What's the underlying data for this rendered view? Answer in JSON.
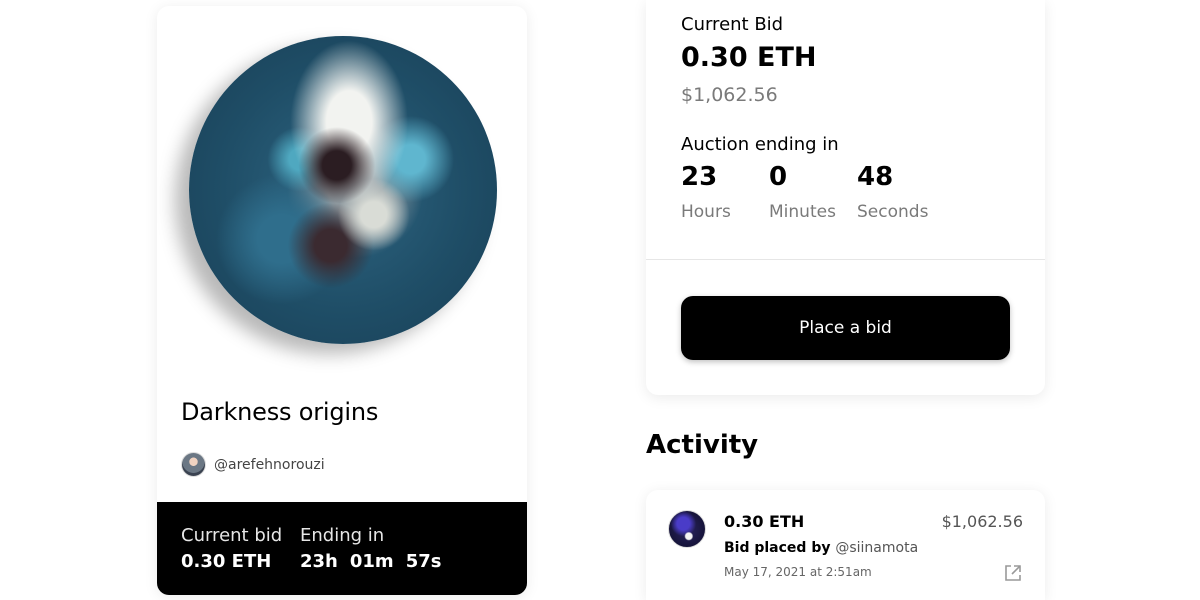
{
  "nft": {
    "title": "Darkness origins",
    "creator_handle": "@arefehnorouzi",
    "artwork_icon": "abstract-fluid-art-circle"
  },
  "footer": {
    "current_bid_label": "Current bid",
    "current_bid_value": "0.30 ETH",
    "ending_label": "Ending in",
    "hours": "23h",
    "minutes": "01m",
    "seconds": "57s"
  },
  "bid_panel": {
    "current_bid_label": "Current Bid",
    "current_bid_eth": "0.30 ETH",
    "current_bid_usd": "$1,062.56",
    "auction_label": "Auction ending in",
    "countdown": [
      {
        "value": "23",
        "label": "Hours"
      },
      {
        "value": "0",
        "label": "Minutes"
      },
      {
        "value": "48",
        "label": "Seconds"
      }
    ],
    "place_bid_label": "Place a bid"
  },
  "activity": {
    "title": "Activity",
    "item": {
      "eth": "0.30 ETH",
      "usd": "$1,062.56",
      "action": "Bid placed by",
      "bidder": "@siinamota",
      "date": "May 17, 2021 at 2:51am",
      "link_icon": "external-link-icon"
    }
  },
  "colors": {
    "background": "#ffffff",
    "primary": "#000000",
    "muted": "#7a7a7a"
  }
}
